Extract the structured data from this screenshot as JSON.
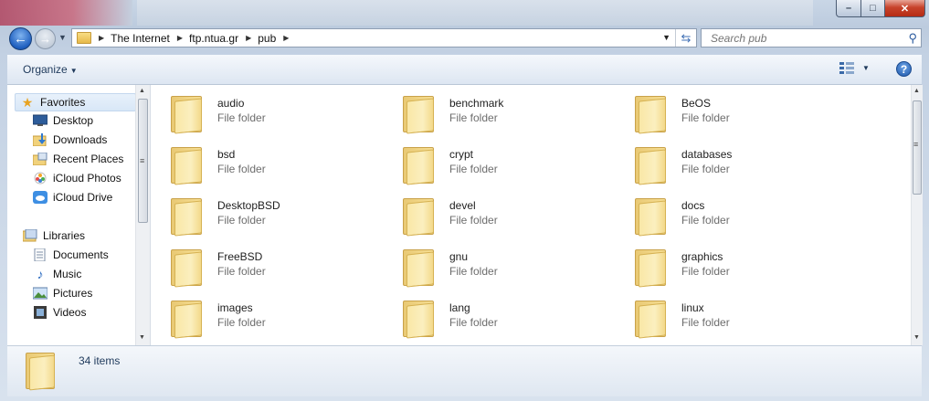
{
  "window": {
    "minimize_glyph": "–",
    "maximize_glyph": "□",
    "close_glyph": "✕"
  },
  "navigation": {
    "back_glyph": "←",
    "forward_glyph": "→",
    "breadcrumbs": [
      "The Internet",
      "ftp.ntua.gr",
      "pub"
    ],
    "search_placeholder": "Search pub"
  },
  "toolbar": {
    "organize_label": "Organize",
    "help_glyph": "?"
  },
  "sidebar": {
    "favorites_label": "Favorites",
    "favorites": [
      {
        "label": "Desktop",
        "icon": "desktop-icon"
      },
      {
        "label": "Downloads",
        "icon": "downloads-icon"
      },
      {
        "label": "Recent Places",
        "icon": "recent-places-icon"
      },
      {
        "label": "iCloud Photos",
        "icon": "icloud-photos-icon"
      },
      {
        "label": "iCloud Drive",
        "icon": "icloud-drive-icon"
      }
    ],
    "libraries_label": "Libraries",
    "libraries": [
      {
        "label": "Documents",
        "icon": "documents-icon"
      },
      {
        "label": "Music",
        "icon": "music-icon"
      },
      {
        "label": "Pictures",
        "icon": "pictures-icon"
      },
      {
        "label": "Videos",
        "icon": "videos-icon"
      }
    ]
  },
  "content": {
    "items": [
      {
        "name": "audio",
        "type": "File folder"
      },
      {
        "name": "benchmark",
        "type": "File folder"
      },
      {
        "name": "BeOS",
        "type": "File folder"
      },
      {
        "name": "bsd",
        "type": "File folder"
      },
      {
        "name": "crypt",
        "type": "File folder"
      },
      {
        "name": "databases",
        "type": "File folder"
      },
      {
        "name": "DesktopBSD",
        "type": "File folder"
      },
      {
        "name": "devel",
        "type": "File folder"
      },
      {
        "name": "docs",
        "type": "File folder"
      },
      {
        "name": "FreeBSD",
        "type": "File folder"
      },
      {
        "name": "gnu",
        "type": "File folder"
      },
      {
        "name": "graphics",
        "type": "File folder"
      },
      {
        "name": "images",
        "type": "File folder"
      },
      {
        "name": "lang",
        "type": "File folder"
      },
      {
        "name": "linux",
        "type": "File folder"
      }
    ]
  },
  "details": {
    "item_count": "34 items"
  }
}
